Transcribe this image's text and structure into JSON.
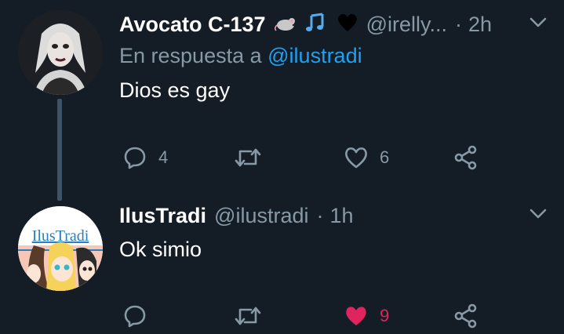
{
  "tweets": [
    {
      "display_name": "Avocato C-137",
      "badge_icons": [
        "mouse-emoji-icon",
        "music-notes-emoji-icon",
        "black-heart-emoji-icon"
      ],
      "handle": "@irelly...",
      "separator": "·",
      "time": "2h",
      "reply_prefix": "En respuesta a",
      "reply_mention": "@ilustradi",
      "text": "Dios es gay",
      "replies": "4",
      "retweets": "",
      "likes": "6",
      "liked": false
    },
    {
      "display_name": "IlusTradi",
      "avatar_text": "IlusTradi",
      "handle": "@ilustradi",
      "separator": "·",
      "time": "1h",
      "text": "Ok simio",
      "replies": "",
      "retweets": "",
      "likes": "9",
      "liked": true
    }
  ],
  "colors": {
    "background": "#141d26",
    "secondary_text": "#8899a6",
    "link": "#1da1f2",
    "like_active": "#e0245e",
    "thread_line": "#3d5466"
  }
}
